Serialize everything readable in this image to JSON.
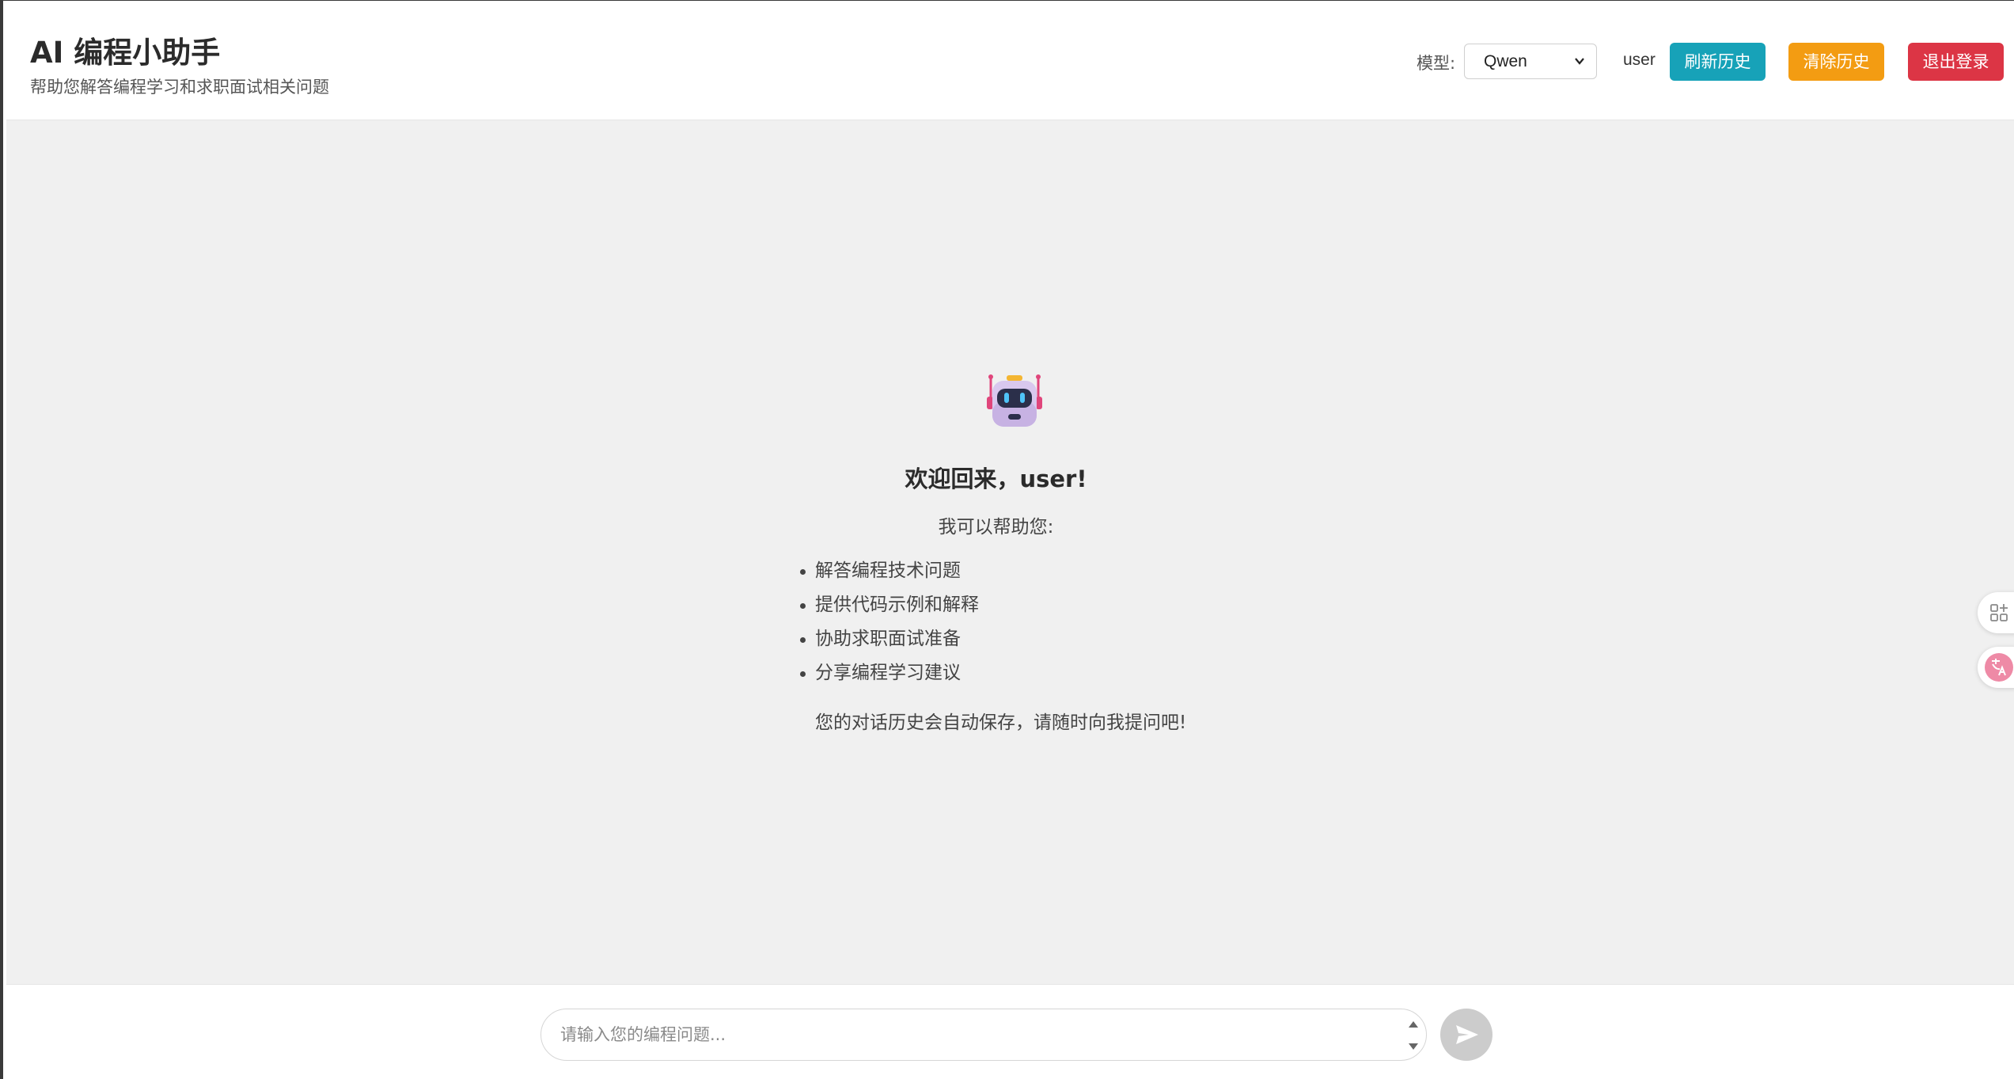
{
  "header": {
    "title": "AI 编程小助手",
    "subtitle": "帮助您解答编程学习和求职面试相关问题",
    "model_label": "模型:",
    "model_selected": "Qwen",
    "username": "user",
    "refresh_label": "刷新历史",
    "clear_label": "清除历史",
    "logout_label": "退出登录"
  },
  "welcome": {
    "title": "欢迎回来，user!",
    "intro": "我可以帮助您:",
    "items": [
      "解答编程技术问题",
      "提供代码示例和解释",
      "协助求职面试准备",
      "分享编程学习建议"
    ],
    "footer": "您的对话历史会自动保存，请随时向我提问吧!"
  },
  "input": {
    "placeholder": "请输入您的编程问题..."
  },
  "icons": {
    "robot": "robot-icon",
    "send": "send-icon",
    "apps": "apps-add-icon",
    "translate": "translate-icon",
    "dropdown": "chevron-down-icon"
  },
  "colors": {
    "refresh": "#17a2b8",
    "clear": "#f39c12",
    "logout": "#dc3545",
    "chat_bg": "#f0f0f0",
    "send_disabled": "#cccccc"
  }
}
